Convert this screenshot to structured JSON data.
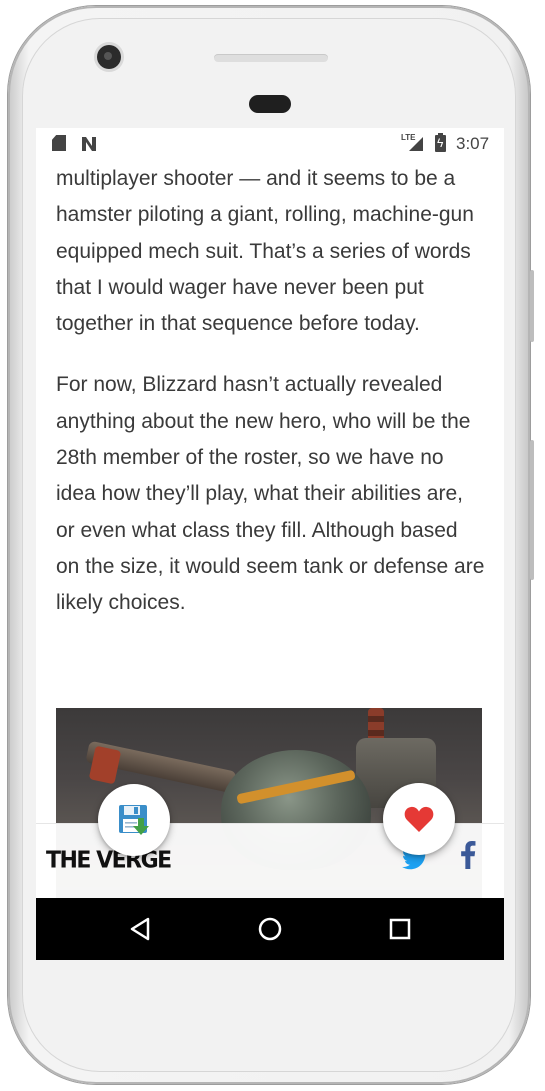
{
  "status_bar": {
    "time": "3:07",
    "network_label": "LTE",
    "icons": [
      "sd-card-icon",
      "nfc-n-icon",
      "lte-signal-icon",
      "battery-charging-icon"
    ]
  },
  "article": {
    "paragraphs": [
      "multiplayer shooter — and it seems to be a hamster piloting a giant, rolling, machine-gun equipped mech suit. That’s a series of words that I would wager have never been put together in that sequence before today.",
      "For now, Blizzard hasn’t actually revealed anything about the new hero, who will be the 28th member of the roster, so we have no idea how they’ll play, what their abilities are, or even what class they fill. Although based on the size, it would seem tank or defense are likely choices."
    ]
  },
  "bottom_bar": {
    "logo_text": "THE VERGE",
    "share_icons": [
      "twitter-icon",
      "facebook-icon"
    ]
  },
  "fabs": {
    "save_icon": "save-floppy-icon",
    "like_icon": "heart-icon"
  },
  "colors": {
    "heart": "#e53935",
    "facebook": "#3b5998",
    "twitter": "#1da1f2",
    "floppy": "#3a8ec9",
    "download_arrow": "#43a047"
  },
  "nav_bar": {
    "icons": [
      "back-triangle-icon",
      "home-circle-icon",
      "recents-square-icon"
    ]
  }
}
